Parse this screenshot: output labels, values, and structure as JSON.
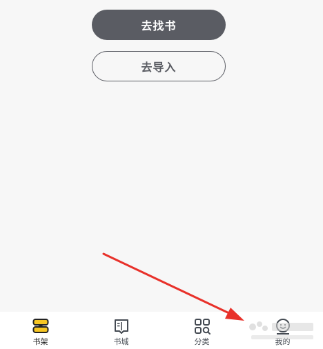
{
  "actions": {
    "find_books_label": "去找书",
    "import_label": "去导入"
  },
  "tabbar": {
    "tabs": [
      {
        "label": "书架",
        "icon": "bookshelf-icon",
        "active": true
      },
      {
        "label": "书城",
        "icon": "book-store-icon",
        "active": false
      },
      {
        "label": "分类",
        "icon": "category-icon",
        "active": false
      },
      {
        "label": "我的",
        "icon": "profile-icon",
        "active": false
      }
    ]
  },
  "colors": {
    "primary_button": "#5a5c63",
    "accent_yellow": "#f7c623",
    "annotation_arrow": "#e8312a"
  }
}
